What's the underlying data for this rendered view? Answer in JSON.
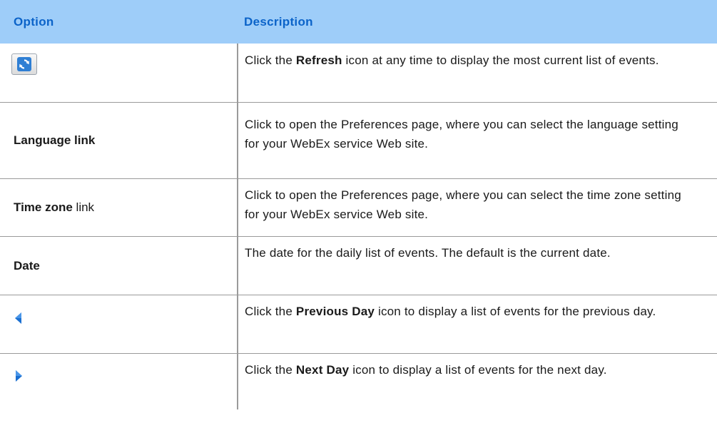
{
  "header": {
    "option": "Option",
    "description": "Description"
  },
  "icons": {
    "refresh": "refresh-icon",
    "previous_day": "left-arrow-icon",
    "next_day": "right-arrow-icon"
  },
  "colors": {
    "header_bg": "#9ecdf9",
    "header_text": "#0b63c9",
    "arrow": "#1a6fd1"
  },
  "rows": [
    {
      "option": "",
      "desc_prefix": "Click the ",
      "desc_bold": "Refresh",
      "desc_suffix": " icon at any time to display the most current list of events."
    },
    {
      "option": "Language link",
      "description": "Click to open the Preferences page, where you can select the language setting for your WebEx service Web site."
    },
    {
      "option_bold": "Time zone",
      "option_suffix": " link",
      "description": "Click to open the Preferences page, where you can select the time zone setting for your WebEx service Web site."
    },
    {
      "option": "Date",
      "description": "The date for the daily list of events. The default is the current date."
    },
    {
      "option": "",
      "desc_prefix": "Click the ",
      "desc_bold": "Previous Day",
      "desc_suffix": " icon to display a list of events for the previous day."
    },
    {
      "option": "",
      "desc_prefix": "Click the ",
      "desc_bold": "Next Day",
      "desc_suffix": " icon to display a list of events for the next day."
    }
  ]
}
